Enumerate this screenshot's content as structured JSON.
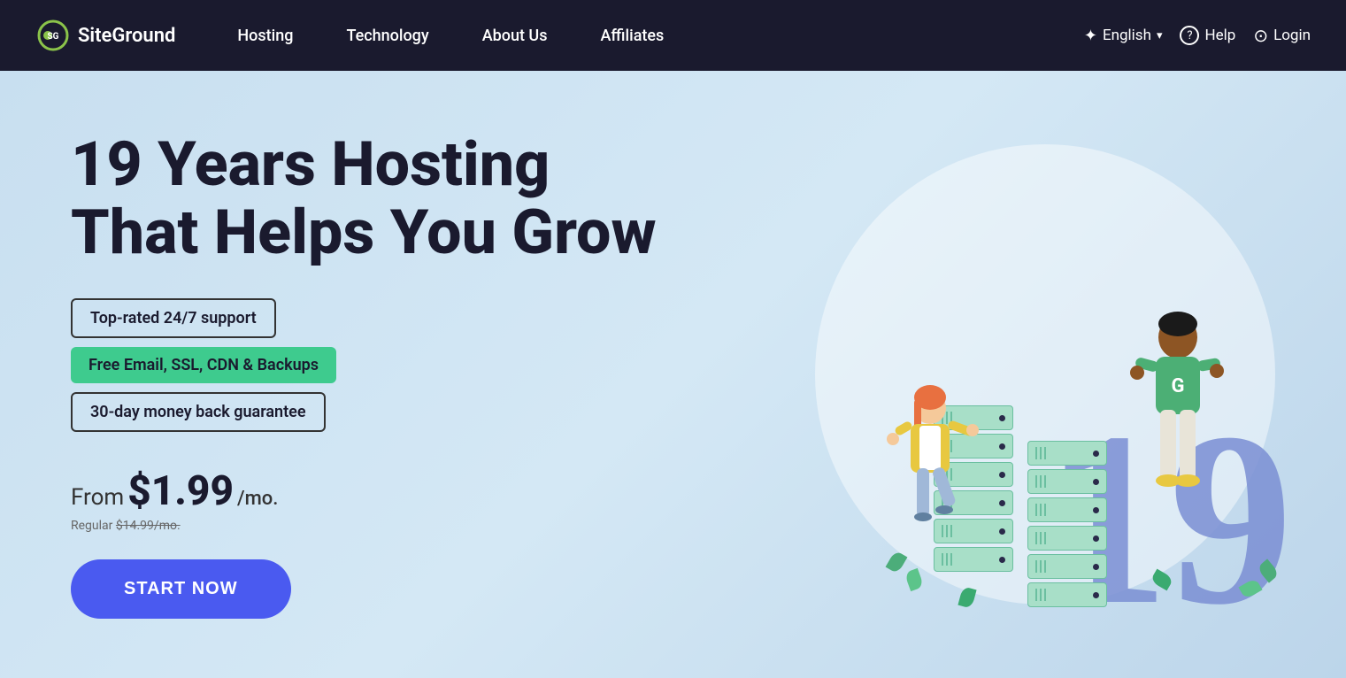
{
  "nav": {
    "logo_text": "SiteGround",
    "links": [
      {
        "id": "hosting",
        "label": "Hosting"
      },
      {
        "id": "technology",
        "label": "Technology"
      },
      {
        "id": "about",
        "label": "About Us"
      },
      {
        "id": "affiliates",
        "label": "Affiliates"
      }
    ],
    "right": {
      "language": "English",
      "help": "Help",
      "login": "Login"
    }
  },
  "hero": {
    "title_line1": "19 Years Hosting",
    "title_line2": "That Helps You Grow",
    "badges": [
      {
        "id": "support",
        "text": "Top-rated 24/7 support",
        "style": "outline"
      },
      {
        "id": "free",
        "text": "Free Email, SSL, CDN & Backups",
        "style": "green"
      },
      {
        "id": "guarantee",
        "text": "30-day money back guarantee",
        "style": "outline"
      }
    ],
    "price_from": "From",
    "price_amount": "$1.99",
    "price_period": "/mo.",
    "price_regular_label": "Regular",
    "price_regular_amount": "$14.99/mo.",
    "cta_label": "START NOW",
    "number_display": "19"
  }
}
